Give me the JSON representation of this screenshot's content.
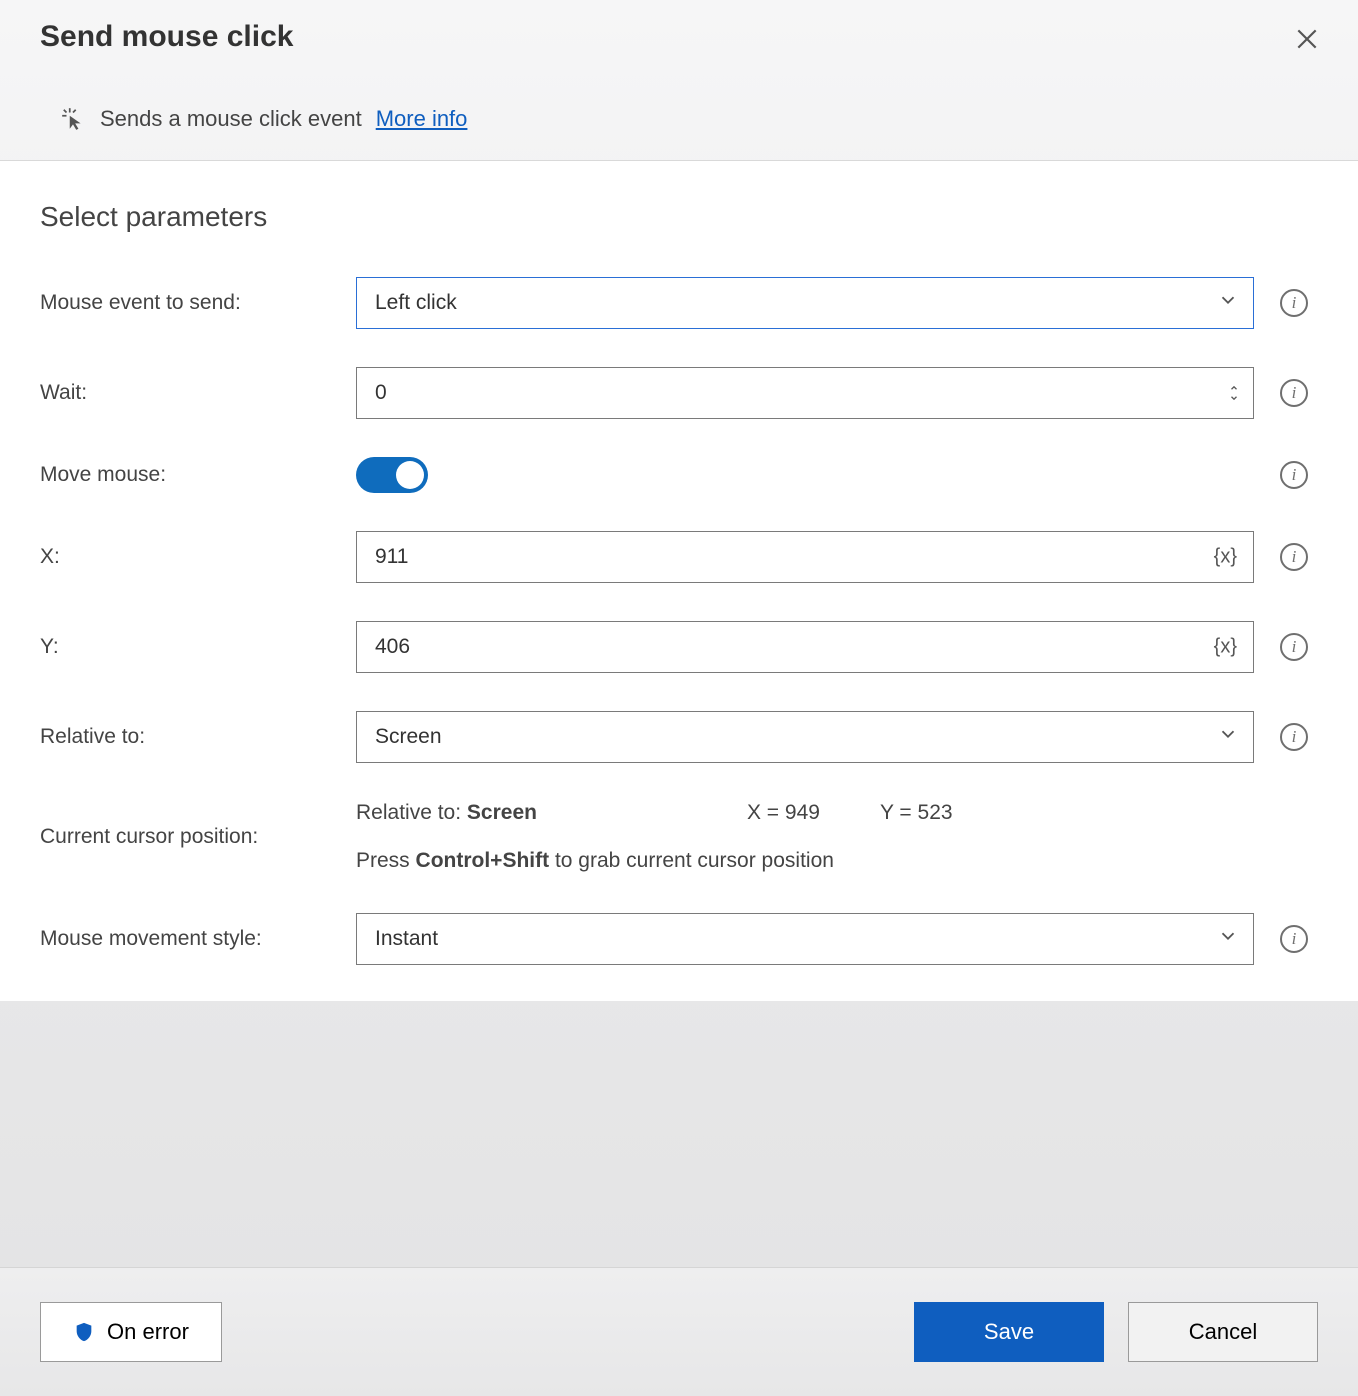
{
  "dialog": {
    "title": "Send mouse click",
    "subtitle": "Sends a mouse click event",
    "more_info": "More info"
  },
  "section": {
    "heading": "Select parameters"
  },
  "fields": {
    "mouse_event": {
      "label": "Mouse event to send:",
      "value": "Left click"
    },
    "wait": {
      "label": "Wait:",
      "value": "0"
    },
    "move_mouse": {
      "label": "Move mouse:",
      "value": true
    },
    "x": {
      "label": "X:",
      "value": "911"
    },
    "y": {
      "label": "Y:",
      "value": "406"
    },
    "relative_to": {
      "label": "Relative to:",
      "value": "Screen"
    },
    "movement": {
      "label": "Mouse movement style:",
      "value": "Instant"
    }
  },
  "cursor": {
    "label": "Current cursor position:",
    "relative_prefix": "Relative to:",
    "relative_value": "Screen",
    "x_label": "X =",
    "x_value": "949",
    "y_label": "Y =",
    "y_value": "523",
    "hint_prefix": "Press",
    "hint_keys": "Control+Shift",
    "hint_suffix": "to grab current cursor position"
  },
  "footer": {
    "on_error": "On error",
    "save": "Save",
    "cancel": "Cancel"
  },
  "glyphs": {
    "var": "{x}"
  }
}
